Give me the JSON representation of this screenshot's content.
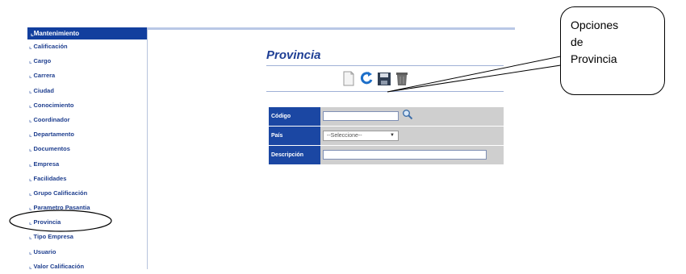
{
  "sidebar": {
    "header": "Mantenimiento",
    "items": [
      "Calificación",
      "Cargo",
      "Carrera",
      "Ciudad",
      "Conocimiento",
      "Coordinador",
      "Departamento",
      "Documentos",
      "Empresa",
      "Facilidades",
      "Grupo Calificación",
      "Parametro Pasantia",
      "Provincia",
      "Tipo Empresa",
      "Usuario",
      "Valor Calificación"
    ]
  },
  "page": {
    "title": "Provincia"
  },
  "toolbar": {
    "icons": [
      "new-document-icon",
      "refresh-icon",
      "save-icon",
      "delete-icon"
    ]
  },
  "form": {
    "codigo_label": "Código",
    "pais_label": "País",
    "pais_value": "--Seleccione--",
    "descripcion_label": "Descripción"
  },
  "callout": {
    "lines": [
      "Opciones",
      "de",
      "Provincia"
    ]
  },
  "colors": {
    "nav_blue": "#123f9e",
    "label_blue": "#1b47a3",
    "title_blue": "#1f3f95",
    "cell_gray": "#cfcfcf"
  }
}
